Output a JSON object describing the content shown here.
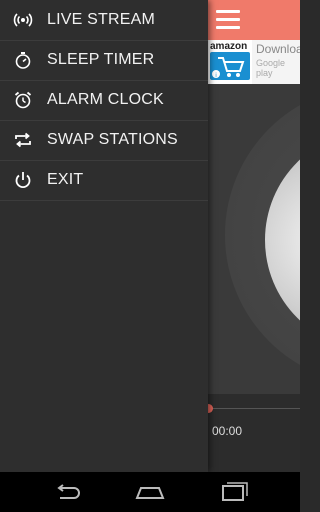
{
  "drawer": {
    "items": [
      {
        "label": "LIVE STREAM",
        "icon": "broadcast-icon"
      },
      {
        "label": "SLEEP TIMER",
        "icon": "stopwatch-icon"
      },
      {
        "label": "ALARM CLOCK",
        "icon": "alarm-clock-icon"
      },
      {
        "label": "SWAP STATIONS",
        "icon": "swap-icon"
      },
      {
        "label": "EXIT",
        "icon": "power-icon"
      }
    ]
  },
  "ad": {
    "brand": "amazon",
    "cta": "Download",
    "store": "Google play"
  },
  "player": {
    "elapsed": "00:00"
  },
  "colors": {
    "accent": "#f07a6a",
    "drawer_bg": "#2e2e2e"
  }
}
